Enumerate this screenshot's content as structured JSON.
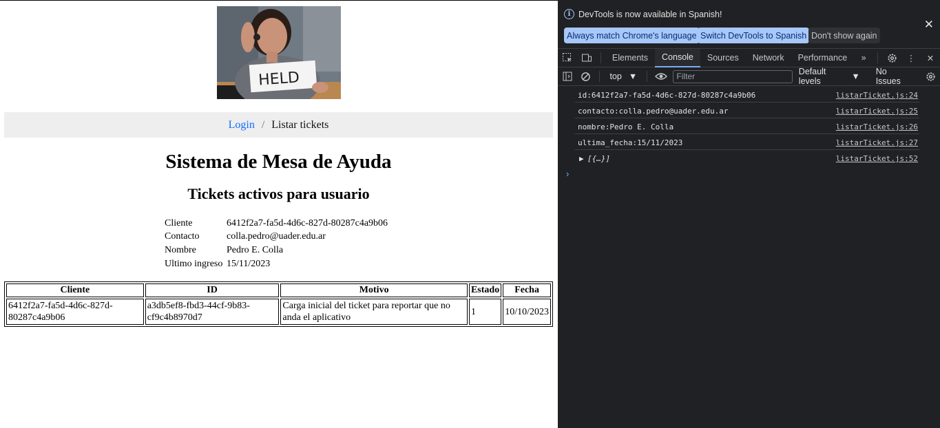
{
  "page": {
    "breadcrumb": {
      "link": "Login",
      "separator": "/",
      "current": "Listar tickets"
    },
    "hero_image": {
      "caption": "HELD"
    },
    "title": "Sistema de Mesa de Ayuda",
    "subtitle": "Tickets activos para usuario",
    "info": [
      {
        "label": "Cliente",
        "value": "6412f2a7-fa5d-4d6c-827d-80287c4a9b06"
      },
      {
        "label": "Contacto",
        "value": "colla.pedro@uader.edu.ar"
      },
      {
        "label": "Nombre",
        "value": "Pedro E. Colla"
      },
      {
        "label": "Ultimo ingreso",
        "value": "15/11/2023"
      }
    ],
    "table": {
      "headers": [
        "Cliente",
        "ID",
        "Motivo",
        "Estado",
        "Fecha"
      ],
      "rows": [
        [
          "6412f2a7-fa5d-4d6c-827d-80287c4a9b06",
          "a3db5ef8-fbd3-44cf-9b83-cf9c4b8970d7",
          "Carga inicial del ticket para reportar que no anda el aplicativo",
          "1",
          "10/10/2023"
        ]
      ]
    }
  },
  "devtools": {
    "infobar": {
      "message": "DevTools is now available in Spanish!",
      "btn_match": "Always match Chrome's language",
      "btn_switch": "Switch DevTools to Spanish",
      "btn_dont_show": "Don't show again"
    },
    "tabs": [
      "Elements",
      "Console",
      "Sources",
      "Network",
      "Performance"
    ],
    "active_tab": "Console",
    "toolbar": {
      "context": "top",
      "filter_placeholder": "Filter",
      "levels": "Default levels",
      "issues": "No Issues"
    },
    "logs": [
      {
        "text": "id:6412f2a7-fa5d-4d6c-827d-80287c4a9b06",
        "source": "listarTicket.js:24"
      },
      {
        "text": "contacto:colla.pedro@uader.edu.ar",
        "source": "listarTicket.js:25"
      },
      {
        "text": "nombre:Pedro E. Colla",
        "source": "listarTicket.js:26"
      },
      {
        "text": "ultima_fecha:15/11/2023",
        "source": "listarTicket.js:27"
      },
      {
        "text": "[{…}]",
        "source": "listarTicket.js:52"
      }
    ],
    "colors": {
      "background": "#202124",
      "accent": "#a8c7fa",
      "link": "#0d6efd"
    }
  }
}
